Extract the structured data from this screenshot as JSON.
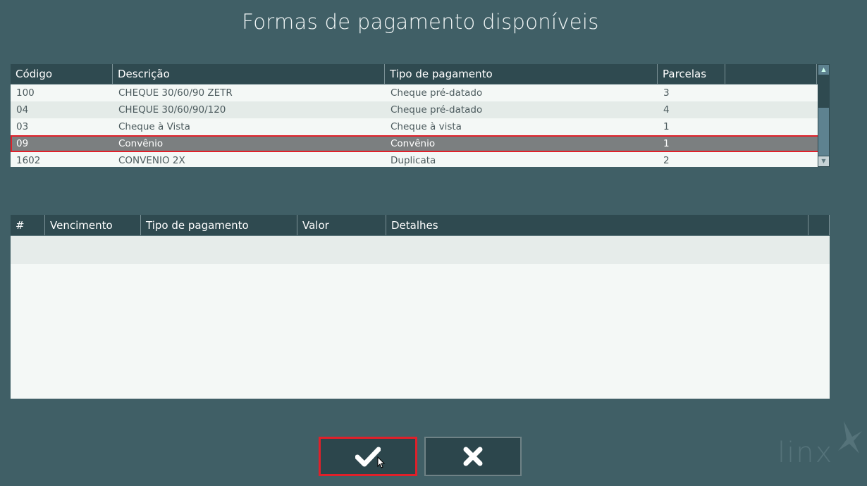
{
  "title": "Formas de pagamento disponíveis",
  "payment_table": {
    "headers": [
      "Código",
      "Descrição",
      "Tipo de pagamento",
      "Parcelas",
      ""
    ],
    "rows": [
      {
        "codigo": "100",
        "descricao": "CHEQUE 30/60/90 ZETR",
        "tipo": "Cheque pré-datado",
        "parcelas": "3"
      },
      {
        "codigo": "04",
        "descricao": "CHEQUE 30/60/90/120",
        "tipo": "Cheque pré-datado",
        "parcelas": "4"
      },
      {
        "codigo": "03",
        "descricao": "Cheque à Vista",
        "tipo": "Cheque à vista",
        "parcelas": "1"
      },
      {
        "codigo": "09",
        "descricao": "Convênio",
        "tipo": "Convênio",
        "parcelas": "1"
      },
      {
        "codigo": "1602",
        "descricao": "CONVENIO 2X",
        "tipo": "Duplicata",
        "parcelas": "2"
      }
    ],
    "selected_index": 3
  },
  "installments_table": {
    "headers": [
      "#",
      "Vencimento",
      "Tipo de pagamento",
      "Valor",
      "Detalhes",
      ""
    ],
    "rows": []
  },
  "buttons": {
    "confirm_icon": "checkmark-icon",
    "cancel_icon": "close-x-icon"
  },
  "logo_text": "linx",
  "colors": {
    "background": "#405f66",
    "header": "#2f4a50",
    "selected_row": "#7b7f80",
    "highlight": "#e0202a"
  }
}
